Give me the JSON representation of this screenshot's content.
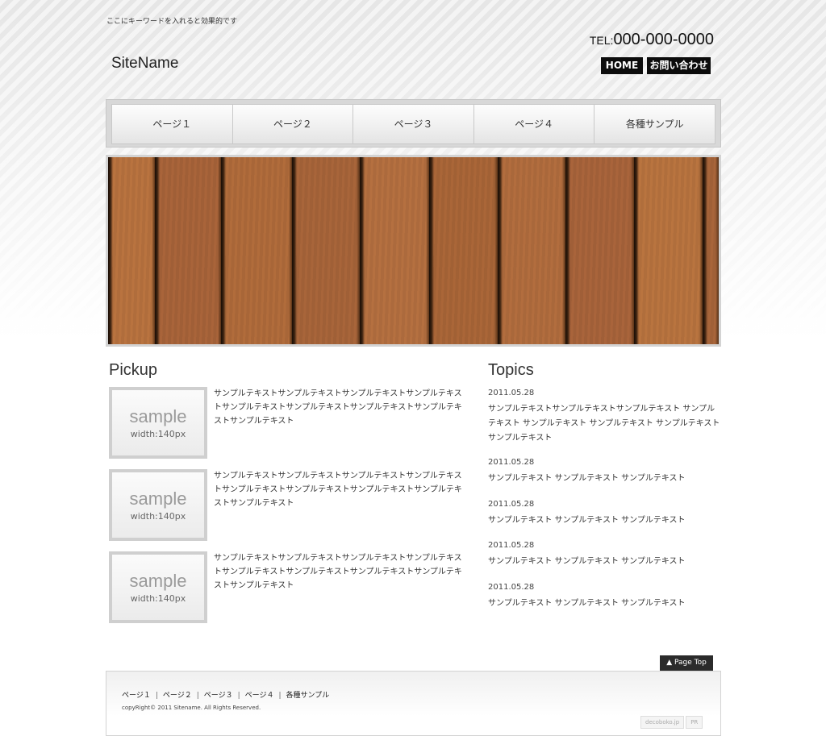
{
  "header": {
    "tagline": "ここにキーワードを入れると効果的です",
    "site_name": "SiteName",
    "tel_label": "TEL:",
    "tel_number": "000-000-0000",
    "home_label": "HOME",
    "contact_label": "お問い合わせ"
  },
  "nav": {
    "items": [
      "ページ１",
      "ページ２",
      "ページ３",
      "ページ４",
      "各種サンプル"
    ]
  },
  "pickup": {
    "title": "Pickup",
    "thumb_word": "sample",
    "thumb_size": "width:140px",
    "items": [
      "サンプルテキストサンプルテキストサンプルテキストサンプルテキストサンプルテキストサンプルテキストサンプルテキストサンプルテキストサンプルテキスト",
      "サンプルテキストサンプルテキストサンプルテキストサンプルテキストサンプルテキストサンプルテキストサンプルテキストサンプルテキストサンプルテキスト",
      "サンプルテキストサンプルテキストサンプルテキストサンプルテキストサンプルテキストサンプルテキストサンプルテキストサンプルテキストサンプルテキスト"
    ]
  },
  "topics": {
    "title": "Topics",
    "items": [
      {
        "date": "2011.05.28",
        "text": "サンプルテキストサンプルテキストサンプルテキスト サンプルテキスト サンプルテキスト サンプルテキスト サンプルテキスト サンプルテキスト"
      },
      {
        "date": "2011.05.28",
        "text": "サンプルテキスト サンプルテキスト サンプルテキスト"
      },
      {
        "date": "2011.05.28",
        "text": "サンプルテキスト サンプルテキスト サンプルテキスト"
      },
      {
        "date": "2011.05.28",
        "text": "サンプルテキスト サンプルテキスト サンプルテキスト"
      },
      {
        "date": "2011.05.28",
        "text": "サンプルテキスト サンプルテキスト サンプルテキスト"
      }
    ]
  },
  "pagetop_label": "▲ Page Top",
  "footer": {
    "links": [
      "ページ１",
      "ページ２",
      "ページ３",
      "ページ４",
      "各種サンプル"
    ],
    "separator": "|",
    "copyright": "copyRight© 2011 Sitename. All Rights Reserved.",
    "badge_left": "decoboko.jp",
    "badge_right": "PR"
  },
  "colors": {
    "accent_dark": "#0c0c0c",
    "wood": "#b06a3a"
  }
}
